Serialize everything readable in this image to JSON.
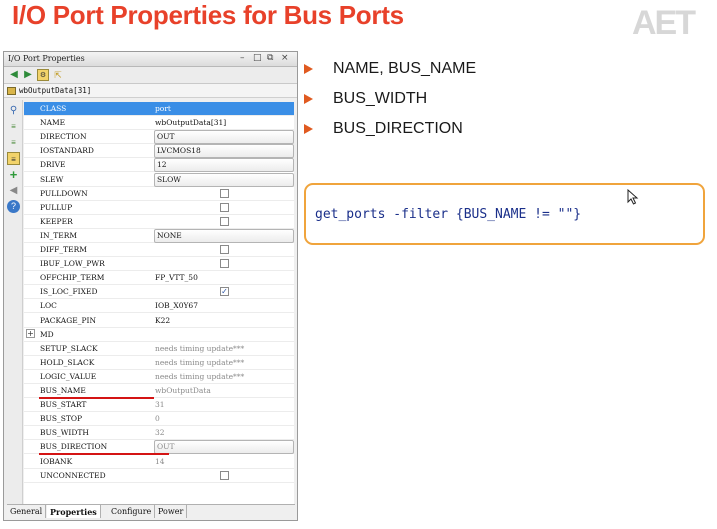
{
  "slide": {
    "title": "I/O Port Properties for Bus Ports",
    "logo": "AET"
  },
  "window": {
    "title": "I/O Port Properties",
    "controls": [
      "–",
      "□",
      "⧉",
      "×"
    ],
    "port_name": "wbOutputData[31]"
  },
  "properties": [
    {
      "name": "CLASS",
      "value": "port",
      "kind": "text",
      "selected": true
    },
    {
      "name": "NAME",
      "value": "wbOutputData[31]",
      "kind": "text"
    },
    {
      "name": "DIRECTION",
      "value": "OUT",
      "kind": "box"
    },
    {
      "name": "IOSTANDARD",
      "value": "LVCMOS18",
      "kind": "box"
    },
    {
      "name": "DRIVE",
      "value": "12",
      "kind": "box"
    },
    {
      "name": "SLEW",
      "value": "SLOW",
      "kind": "box"
    },
    {
      "name": "PULLDOWN",
      "value": "",
      "kind": "check",
      "checked": false
    },
    {
      "name": "PULLUP",
      "value": "",
      "kind": "check",
      "checked": false
    },
    {
      "name": "KEEPER",
      "value": "",
      "kind": "check",
      "checked": false
    },
    {
      "name": "IN_TERM",
      "value": "NONE",
      "kind": "box"
    },
    {
      "name": "DIFF_TERM",
      "value": "",
      "kind": "check",
      "checked": false
    },
    {
      "name": "IBUF_LOW_PWR",
      "value": "",
      "kind": "check",
      "checked": false
    },
    {
      "name": "OFFCHIP_TERM",
      "value": "FP_VTT_50",
      "kind": "text"
    },
    {
      "name": "IS_LOC_FIXED",
      "value": "",
      "kind": "check",
      "checked": true
    },
    {
      "name": "LOC",
      "value": "IOB_X0Y67",
      "kind": "text"
    },
    {
      "name": "PACKAGE_PIN",
      "value": "K22",
      "kind": "text"
    },
    {
      "name": "MD",
      "value": "",
      "kind": "group"
    },
    {
      "name": "SETUP_SLACK",
      "value": "needs timing update***",
      "kind": "grey"
    },
    {
      "name": "HOLD_SLACK",
      "value": "needs timing update***",
      "kind": "grey"
    },
    {
      "name": "LOGIC_VALUE",
      "value": "needs timing update***",
      "kind": "grey"
    },
    {
      "name": "BUS_NAME",
      "value": "wbOutputData",
      "kind": "grey",
      "underline": true
    },
    {
      "name": "BUS_START",
      "value": "31",
      "kind": "grey"
    },
    {
      "name": "BUS_STOP",
      "value": "0",
      "kind": "grey"
    },
    {
      "name": "BUS_WIDTH",
      "value": "32",
      "kind": "grey"
    },
    {
      "name": "BUS_DIRECTION",
      "value": "OUT",
      "kind": "greybox",
      "underline": true
    },
    {
      "name": "IOBANK",
      "value": "14",
      "kind": "grey"
    },
    {
      "name": "UNCONNECTED",
      "value": "",
      "kind": "check",
      "checked": false
    }
  ],
  "tabs": [
    {
      "label": "General",
      "active": false
    },
    {
      "label": "Properties",
      "active": true
    },
    {
      "label": "Configure",
      "active": false
    },
    {
      "label": "Power",
      "active": false
    }
  ],
  "bullets": [
    "NAME, BUS_NAME",
    "BUS_WIDTH",
    "BUS_DIRECTION"
  ],
  "code": "get_ports -filter {BUS_NAME != \"\"}",
  "colors": {
    "title": "#e8412a",
    "bullet_arrow": "#e05a20",
    "code_border": "#f0a43c",
    "code_text": "#1a2f8a",
    "selection": "#3a8ee6",
    "underline": "#d41414"
  }
}
